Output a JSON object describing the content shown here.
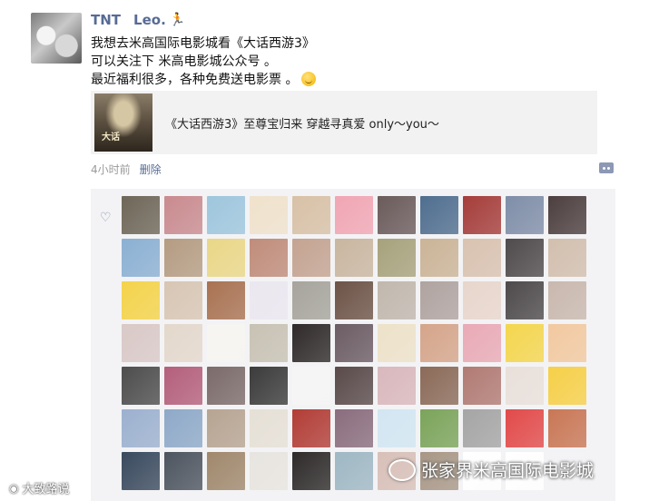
{
  "post": {
    "author": "TNT",
    "author2": "Leo.",
    "lines": [
      "我想去米高国际电影城看《大话西游3》",
      "可以关注下  米高电影城公众号 。",
      "最近福利很多，各种免费送电影票 。"
    ],
    "link_title": "《大话西游3》至尊宝归来  穿越寻真爱  only～you～",
    "time": "4小时前",
    "delete_label": "删除"
  },
  "watermarks": {
    "left": "大致路说",
    "right": "张家界米高国际电影城"
  },
  "icons": [
    "runner-icon",
    "smile-icon",
    "comment-icon",
    "heart-icon",
    "weibo-icon",
    "wechat-icon"
  ],
  "liker_avatars": [
    "#6e6658",
    "#c98b8f",
    "#9ec6dd",
    "#f0e2cc",
    "#d8c1a6",
    "#f1a6b4",
    "#6b5b5b",
    "#4f6e8f",
    "#a53d3a",
    "#7f8ea8",
    "#4d3f3f",
    "#8bb0d3",
    "#b59c82",
    "#ead787",
    "#c08c7a",
    "#c4a391",
    "#c9b6a0",
    "#a7a27c",
    "#cbb497",
    "#d9c2b0",
    "#4f4a4c",
    "#d2bfae",
    "#f4d34a",
    "#d8c6b4",
    "#a97252",
    "#ebe7f0",
    "#a6a49c",
    "#6d5347",
    "#c1b7ad",
    "#b0a3a0",
    "#e8d6cc",
    "#4e4a4c",
    "#c9b8ae",
    "#d9c9c7",
    "#e4d8cc",
    "#f7f5f2",
    "#c8c2b4",
    "#2f2a29",
    "#6c5c64",
    "#ede2c9",
    "#d5a58a",
    "#e9aab6",
    "#f4d64e",
    "#f2c9a0",
    "#4d4d4d",
    "#b45f7b",
    "#7b6b6a",
    "#3b3b3b",
    "#f5f5f5",
    "#5a4a4a",
    "#d9b8bc",
    "#8b6a58",
    "#b17a73",
    "#e9e0da",
    "#f6d048",
    "#9cb1cf",
    "#8ea9c8",
    "#b7a492",
    "#e6e0d6",
    "#b23d36",
    "#8a6d7e",
    "#d2e6f2",
    "#7ba45a",
    "#a5a5a5",
    "#e24a4a",
    "#c97755",
    "#3a4a5e",
    "#4d5560",
    "#a0886c",
    "#e8e5e0",
    "#2e2a2a",
    "#9fb8c4",
    "#d8c0b8",
    "#a89786",
    "#ffffff",
    "#ffffff"
  ]
}
